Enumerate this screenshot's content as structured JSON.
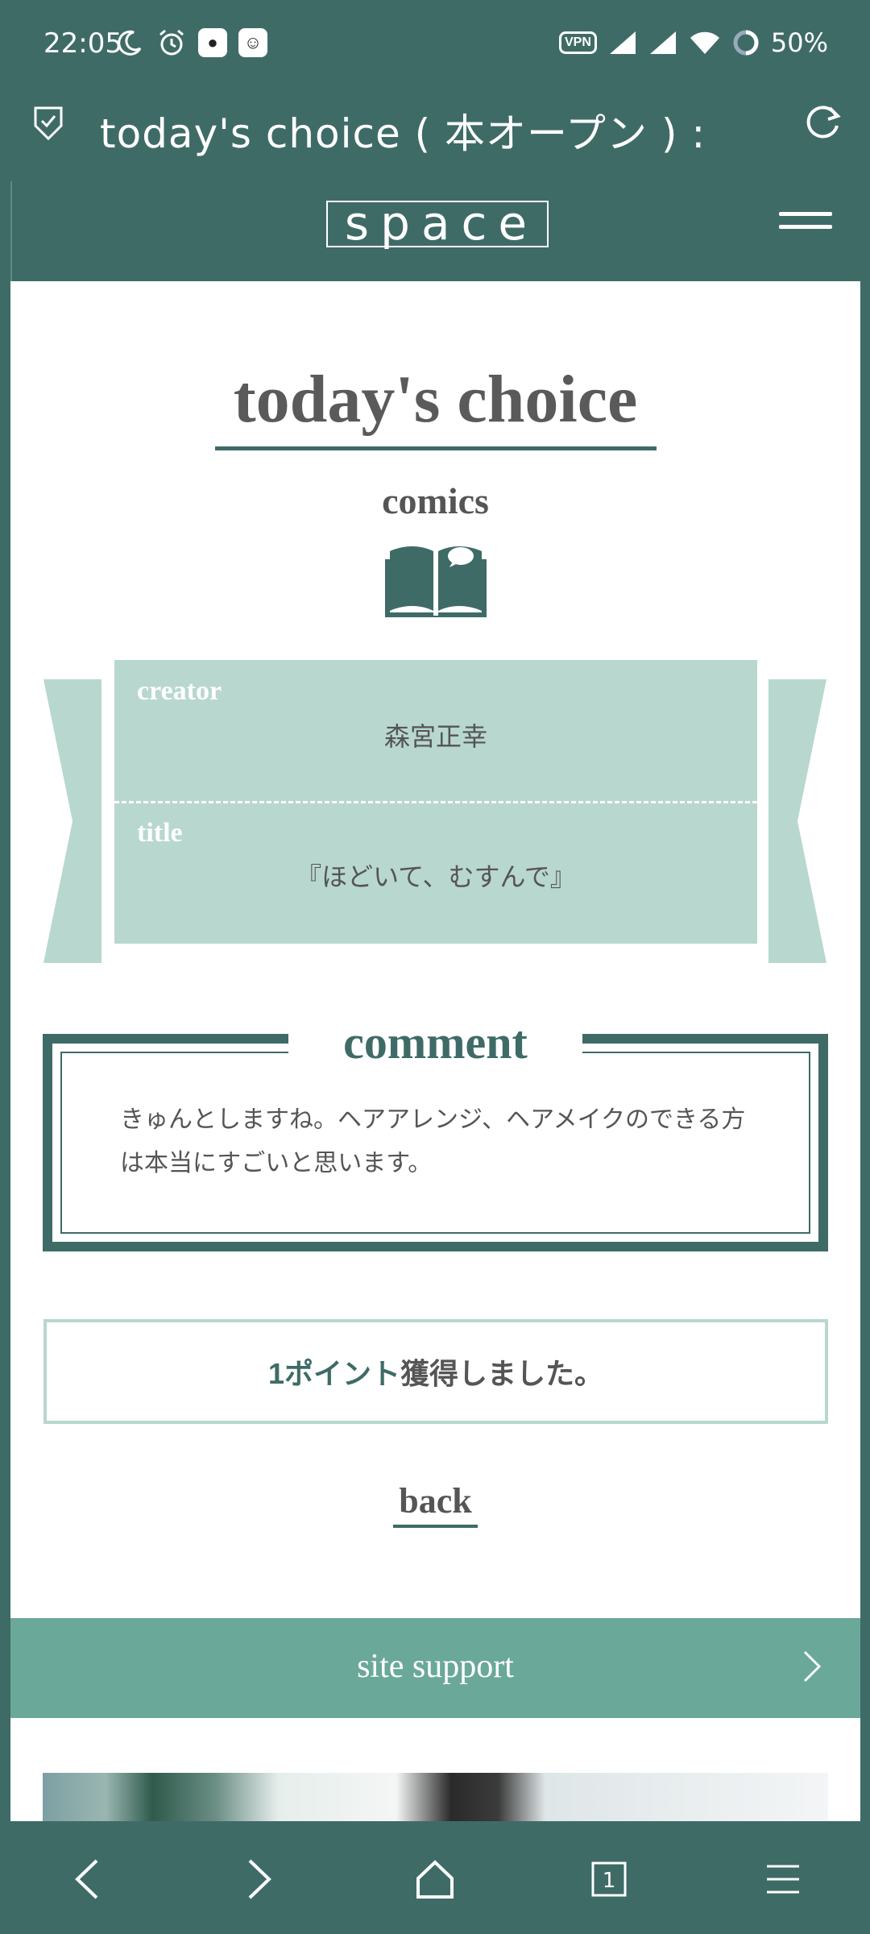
{
  "status_bar": {
    "time": "22:05",
    "vpn": "VPN",
    "battery": "50%"
  },
  "browser": {
    "tab_title": "today's choice ( 本オープン ) :"
  },
  "site": {
    "logo": "space"
  },
  "page": {
    "title": "today's choice",
    "category": "comics",
    "creator_label": "creator",
    "creator_value": "森宮正幸",
    "title_label": "title",
    "title_value": "『ほどいて、むすんで』",
    "comment_heading": "comment",
    "comment_text": "きゅんとしますね。ヘアアレンジ、ヘアメイクのできる方は本当にすごいと思います。",
    "points_accent": "1ポイント",
    "points_rest": "獲得しました。",
    "back_label": "back",
    "site_support_label": "site support"
  },
  "colors": {
    "theme": "#3f6b67",
    "ribbon": "#b8d7cf",
    "support_bar": "#6aa89a"
  },
  "icons": {
    "status_left": [
      "moon-icon",
      "alarm-icon",
      "qq-app-icon",
      "app-icon"
    ],
    "status_right": [
      "vpn-icon",
      "signal-icon",
      "signal-icon",
      "wifi-icon",
      "battery-icon"
    ],
    "url_bar": [
      "shield-check-icon",
      "reload-icon"
    ],
    "bottom_nav": [
      "back-arrow-icon",
      "forward-arrow-icon",
      "home-icon",
      "tabs-icon",
      "menu-icon"
    ]
  },
  "bottom_nav": {
    "tab_count": "1"
  }
}
